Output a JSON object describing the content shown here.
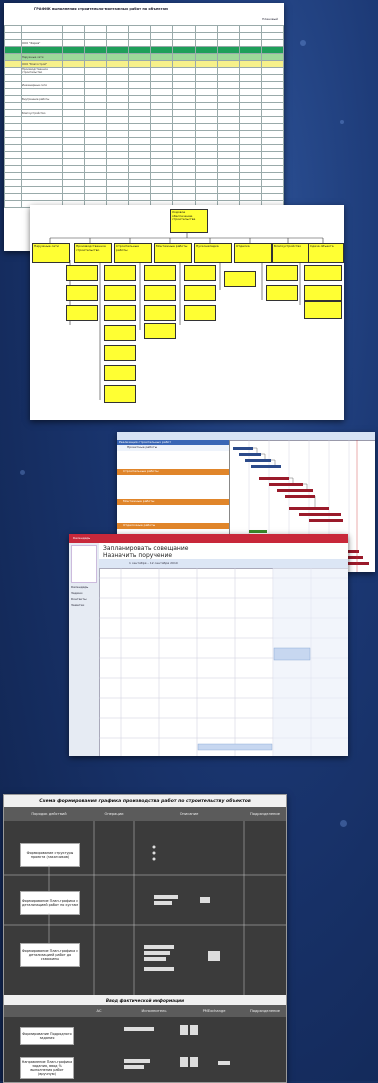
{
  "shot1": {
    "title": "ГРАФИК выполнения строительно-монтажных работ по объектам",
    "header_right": "Плановый",
    "row_labels": [
      "ООО \"Фарма\"",
      "Наружные сети",
      "ООО \"Благострой\"",
      "Производственное строительство",
      "Инженерные сети",
      "Внутренние работы",
      "Благоустройство"
    ]
  },
  "shot2": {
    "root_label": "Ходовое обеспечение строительства",
    "nodes": [
      "Наружные сети",
      "Производственное строительство",
      "Строительные работы",
      "Монтажные работы",
      "Пусконаладка",
      "Отделка",
      "Благоустройство",
      "Сдача объекта"
    ]
  },
  "shot3": {
    "header": "Реализация строительных работ",
    "tasks": [
      "Проектные работы",
      "Строительные работы",
      "Монтажные работы",
      "Отделочные работы",
      "Пусконаладочные работы",
      "Сдача объекта"
    ]
  },
  "shot4": {
    "window_title": "Календарь",
    "menu": [
      "Запланировать совещание",
      "Назначить поручение"
    ],
    "date_range": "1 сентября – 12 сентября 2010",
    "nav": [
      "Календарь",
      "Задачи",
      "Контакты",
      "Заметки"
    ]
  },
  "shot5": {
    "title": "Схема формирования графика производства работ по строительству объектов",
    "col_heads": [
      "Порядок действий",
      "Операции",
      "Описание",
      "Подразделение"
    ],
    "steps": [
      "Формирование структуры проекта (заказчиков)",
      "Формирование План-графика с детализацией работ по кустам",
      "Формирование План-графика с детализацией работ до скважины"
    ],
    "section2": "Ввод фактической информации",
    "col_heads2": [
      "",
      "АС",
      "Исполнитель",
      "PMExchange",
      "Подразделение"
    ],
    "steps2": [
      "Формирование Подрядного задания",
      "Направление План-графика задания, ввод % выполнения работ (вручную)"
    ]
  }
}
